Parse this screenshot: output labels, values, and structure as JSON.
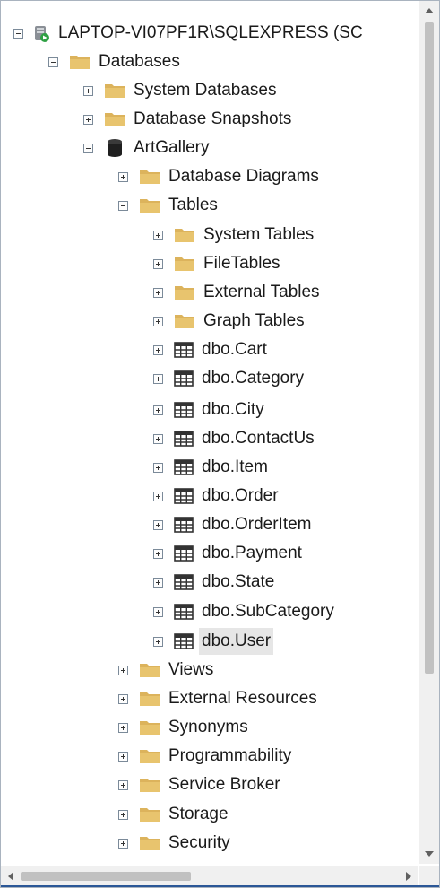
{
  "tree": {
    "nodes": [
      {
        "label": "LAPTOP-VI07PF1R\\SQLEXPRESS (SC",
        "icon": "server-icon",
        "expanded": true
      },
      {
        "label": "Databases",
        "icon": "folder-icon",
        "expanded": true
      },
      {
        "label": "System Databases",
        "icon": "folder-icon",
        "expanded": false
      },
      {
        "label": "Database Snapshots",
        "icon": "folder-icon",
        "expanded": false
      },
      {
        "label": "ArtGallery",
        "icon": "database-icon",
        "expanded": true
      },
      {
        "label": "Database Diagrams",
        "icon": "folder-icon",
        "expanded": false
      },
      {
        "label": "Tables",
        "icon": "folder-icon",
        "expanded": true
      },
      {
        "label": "System Tables",
        "icon": "folder-icon",
        "expanded": false
      },
      {
        "label": "FileTables",
        "icon": "folder-icon",
        "expanded": false
      },
      {
        "label": "External Tables",
        "icon": "folder-icon",
        "expanded": false
      },
      {
        "label": "Graph Tables",
        "icon": "folder-icon",
        "expanded": false
      },
      {
        "label": "dbo.Cart",
        "icon": "table-icon",
        "expanded": false
      },
      {
        "label": "dbo.Category",
        "icon": "table-icon",
        "expanded": false
      },
      {
        "label": "dbo.City",
        "icon": "table-icon",
        "expanded": false
      },
      {
        "label": "dbo.ContactUs",
        "icon": "table-icon",
        "expanded": false
      },
      {
        "label": "dbo.Item",
        "icon": "table-icon",
        "expanded": false
      },
      {
        "label": "dbo.Order",
        "icon": "table-icon",
        "expanded": false
      },
      {
        "label": "dbo.OrderItem",
        "icon": "table-icon",
        "expanded": false
      },
      {
        "label": "dbo.Payment",
        "icon": "table-icon",
        "expanded": false
      },
      {
        "label": "dbo.State",
        "icon": "table-icon",
        "expanded": false
      },
      {
        "label": "dbo.SubCategory",
        "icon": "table-icon",
        "expanded": false
      },
      {
        "label": "dbo.User",
        "icon": "table-icon",
        "expanded": false,
        "selected": true
      },
      {
        "label": "Views",
        "icon": "folder-icon",
        "expanded": false
      },
      {
        "label": "External Resources",
        "icon": "folder-icon",
        "expanded": false
      },
      {
        "label": "Synonyms",
        "icon": "folder-icon",
        "expanded": false
      },
      {
        "label": "Programmability",
        "icon": "folder-icon",
        "expanded": false
      },
      {
        "label": "Service Broker",
        "icon": "folder-icon",
        "expanded": false
      },
      {
        "label": "Storage",
        "icon": "folder-icon",
        "expanded": false
      },
      {
        "label": "Security",
        "icon": "folder-icon",
        "expanded": false
      }
    ]
  },
  "colors": {
    "folder": "#dcb35c",
    "database": "#1f1f1f",
    "server_badge": "#2ea043",
    "selection": "#e6e6e6"
  }
}
